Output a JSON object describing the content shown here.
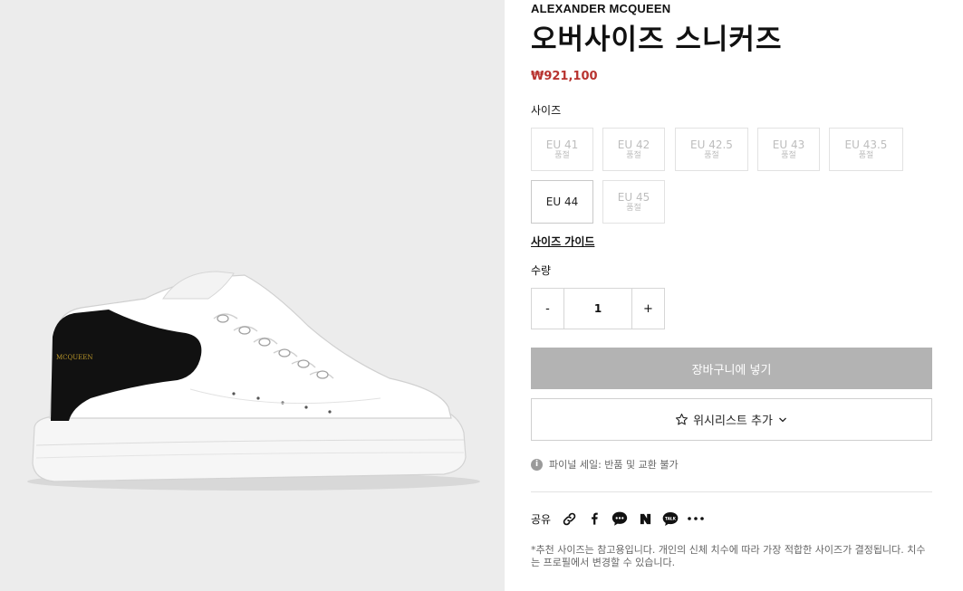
{
  "product": {
    "brand": "ALEXANDER MCQUEEN",
    "title": "오버사이즈 스니커즈",
    "price": "₩921,100",
    "heel_text": "MCQUEEN"
  },
  "size": {
    "label": "사이즈",
    "options": [
      {
        "name": "EU 41",
        "stock": "품절"
      },
      {
        "name": "EU 42",
        "stock": "품절"
      },
      {
        "name": "EU 42.5",
        "stock": "품절"
      },
      {
        "name": "EU 43",
        "stock": "품절"
      },
      {
        "name": "EU 43.5",
        "stock": "품절"
      },
      {
        "name": "EU 44",
        "stock": ""
      },
      {
        "name": "EU 45",
        "stock": "품절"
      }
    ],
    "guide_label": "사이즈 가이드"
  },
  "quantity": {
    "label": "수량",
    "minus": "-",
    "value": "1",
    "plus": "+"
  },
  "actions": {
    "add_to_cart": "장바구니에 넣기",
    "wishlist": "위시리스트 추가"
  },
  "notice": {
    "icon": "i",
    "text": "파이널 세일: 반품 및 교환 불가"
  },
  "share": {
    "label": "공유",
    "icons": [
      "link-icon",
      "facebook-icon",
      "chat-bubble-icon",
      "naver-icon",
      "kakaotalk-icon",
      "more-icon"
    ],
    "kakao_text": "TALK"
  },
  "footnote": "*추천 사이즈는 참고용입니다. 개인의 신체 치수에 따라 가장 적합한 사이즈가 결정됩니다. 치수는 프로필에서 변경할 수 있습니다.",
  "colors": {
    "price": "#b8332f",
    "cart_button_bg": "#b3b3b3",
    "image_bg": "#ececec"
  }
}
